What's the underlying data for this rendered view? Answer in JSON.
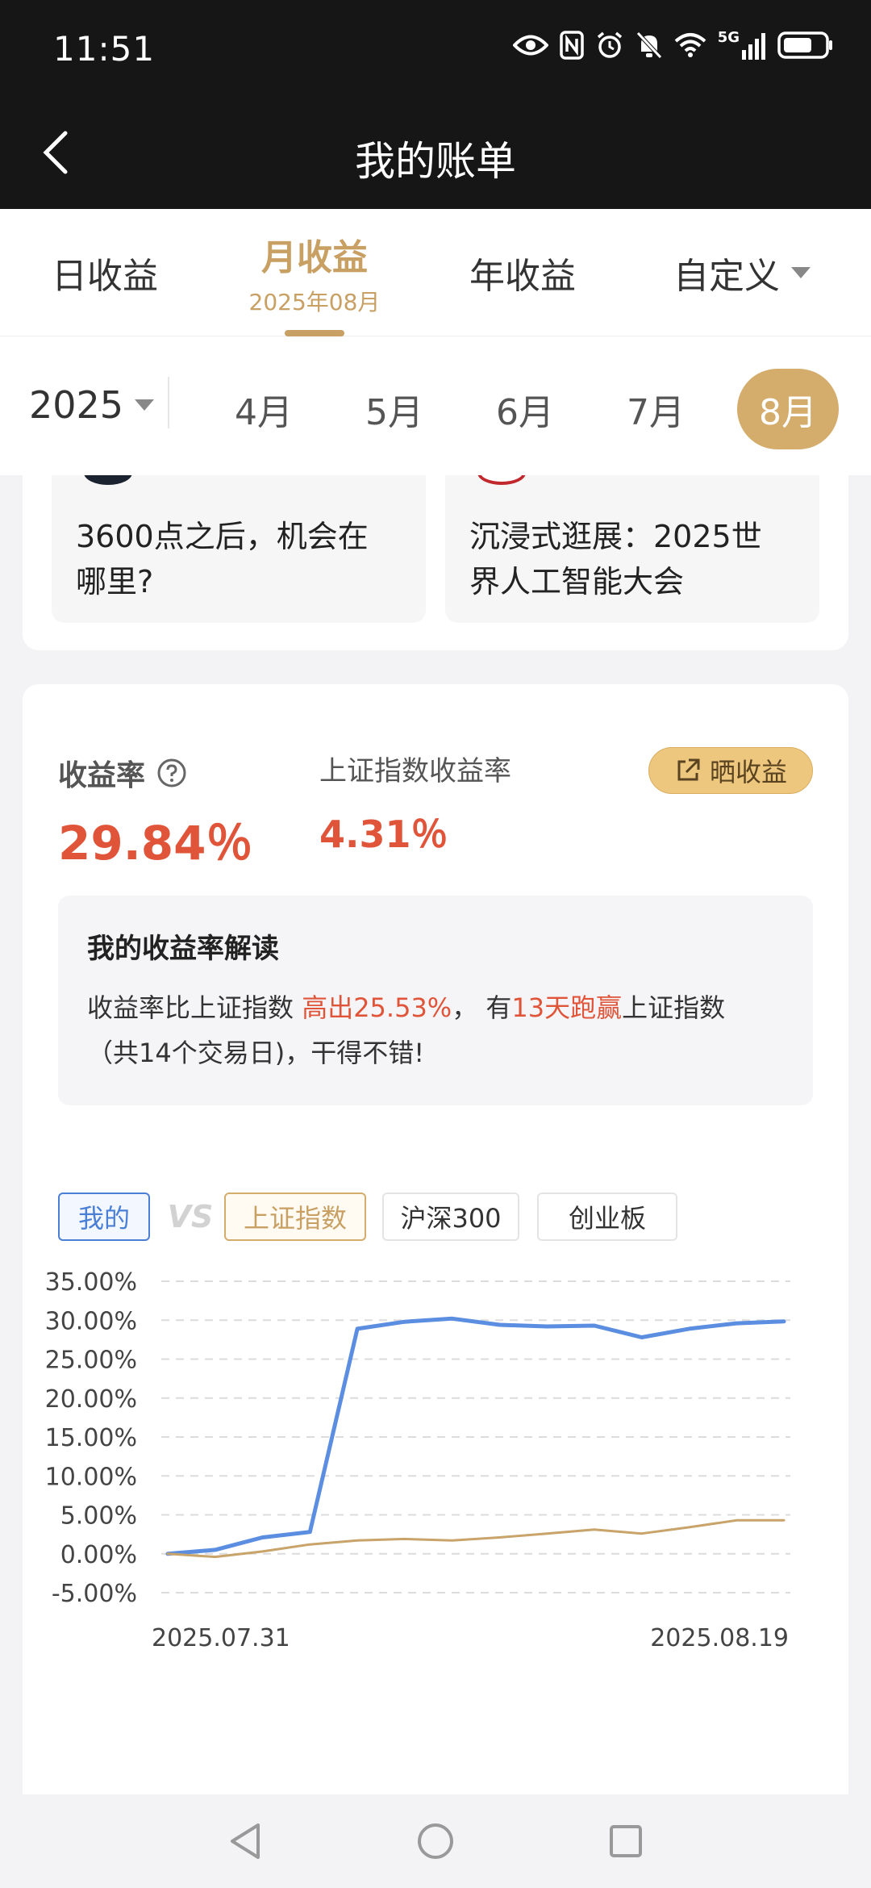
{
  "status_bar": {
    "time": "11:51",
    "network": "5G"
  },
  "nav": {
    "title": "我的账单"
  },
  "period_tabs": [
    {
      "label": "日收益",
      "active": false
    },
    {
      "label": "月收益",
      "sub": "2025年08月",
      "active": true
    },
    {
      "label": "年收益",
      "active": false
    },
    {
      "label": "自定义",
      "active": false,
      "dropdown": true
    }
  ],
  "month_bar": {
    "year": "2025",
    "months": [
      "4月",
      "5月",
      "6月",
      "7月",
      "8月"
    ],
    "selected": "8月"
  },
  "articles": [
    {
      "title_line1": "3600点之后，机会在",
      "title_line2": "哪里?"
    },
    {
      "title_line1": "沉浸式逛展：2025世",
      "title_line2": "界人工智能大会"
    }
  ],
  "yield": {
    "label": "收益率",
    "value": "29.84％",
    "index_label": "上证指数收益率",
    "index_value": "4.31％",
    "share_button": "晒收益"
  },
  "interpretation": {
    "title": "我的收益率解读",
    "p1": "收益率比上证指数 ",
    "p1_hl": "高出25.53%",
    "p2": "， 有",
    "p2_hl": "13天跑赢",
    "p3": "上证指数",
    "line2": "（共14个交易日)，干得不错!"
  },
  "compare": {
    "mine": "我的",
    "vs": "VS",
    "index_sh": "上证指数",
    "index_hs300": "沪深300",
    "index_cyb": "创业板"
  },
  "colors": {
    "gold": "#c9a063",
    "red": "#e0553a",
    "mine_line": "#5b8ee0",
    "index_line": "#c8a36a"
  },
  "chart_data": {
    "type": "line",
    "x_start_label": "2025.07.31",
    "x_end_label": "2025.08.19",
    "ylim": [
      -5,
      35
    ],
    "y_ticks": [
      "35.00%",
      "30.00%",
      "25.00%",
      "20.00%",
      "15.00%",
      "10.00%",
      "5.00%",
      "0.00%",
      "-5.00%"
    ],
    "y_tick_values": [
      35,
      30,
      25,
      20,
      15,
      10,
      5,
      0,
      -5
    ],
    "grid": true,
    "series": [
      {
        "name": "我的",
        "values": [
          0,
          0.5,
          2.1,
          2.8,
          28.9,
          29.8,
          30.2,
          29.4,
          29.2,
          29.3,
          27.8,
          28.9,
          29.6,
          29.84
        ]
      },
      {
        "name": "上证指数",
        "values": [
          0,
          -0.4,
          0.3,
          1.2,
          1.7,
          1.9,
          1.7,
          2.1,
          2.6,
          3.1,
          2.6,
          3.4,
          4.3,
          4.31
        ]
      }
    ]
  }
}
